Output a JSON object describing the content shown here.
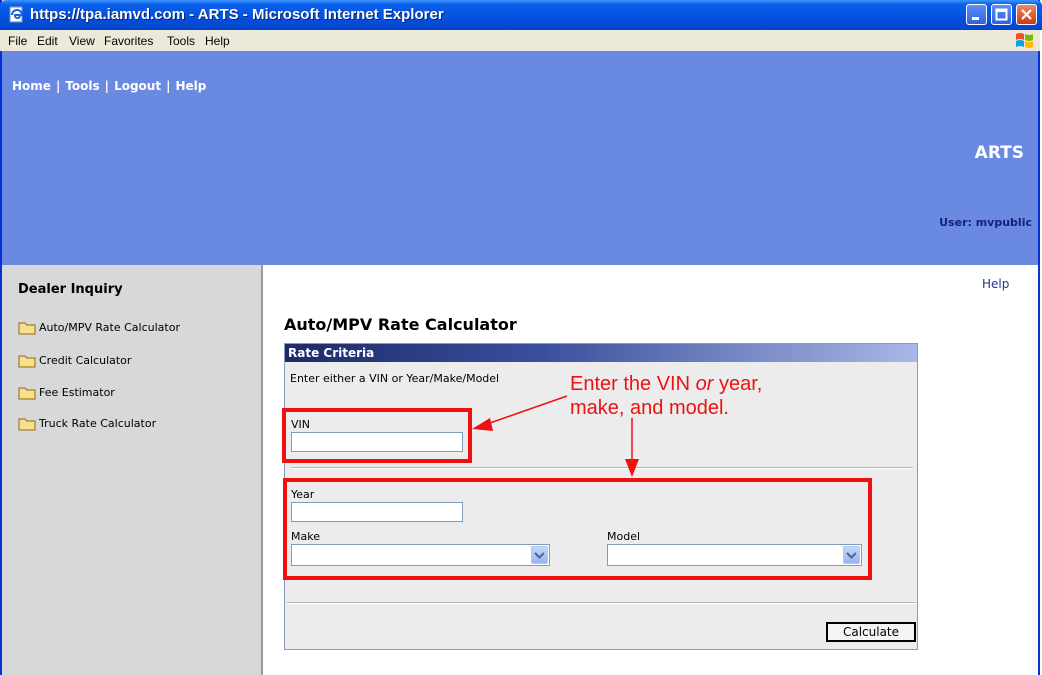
{
  "window": {
    "title": "https://tpa.iamvd.com - ARTS - Microsoft Internet Explorer"
  },
  "menu": [
    "File",
    "Edit",
    "View",
    "Favorites",
    "Tools",
    "Help"
  ],
  "nav": {
    "links": [
      "Home",
      "Tools",
      "Logout",
      "Help"
    ],
    "separator": "|"
  },
  "banner": {
    "app_name": "ARTS",
    "user": "User: mvpublic"
  },
  "sidebar": {
    "title": "Dealer Inquiry",
    "items": [
      {
        "label": "Auto/MPV Rate Calculator",
        "icon": "folder-icon"
      },
      {
        "label": "Credit Calculator",
        "icon": "folder-icon"
      },
      {
        "label": "Fee Estimator",
        "icon": "folder-icon"
      },
      {
        "label": "Truck Rate Calculator",
        "icon": "folder-icon"
      }
    ]
  },
  "main": {
    "help_link": "Help",
    "page_title": "Auto/MPV Rate Calculator",
    "panel_title": "Rate Criteria",
    "instructions": "Enter either a VIN or Year/Make/Model",
    "vin": {
      "label": "VIN",
      "value": ""
    },
    "year": {
      "label": "Year",
      "value": ""
    },
    "make": {
      "label": "Make",
      "selected": ""
    },
    "model": {
      "label": "Model",
      "selected": ""
    },
    "calculate_label": "Calculate"
  },
  "annotation": {
    "line1_a": "Enter the VIN ",
    "line1_em": "or",
    "line1_b": " year,",
    "line2": "make, and model."
  },
  "colors": {
    "banner": "#6a89e0",
    "sidebar": "#d8d8d8",
    "annotation_red": "#ee1111",
    "titlebar": "#0551e0"
  }
}
